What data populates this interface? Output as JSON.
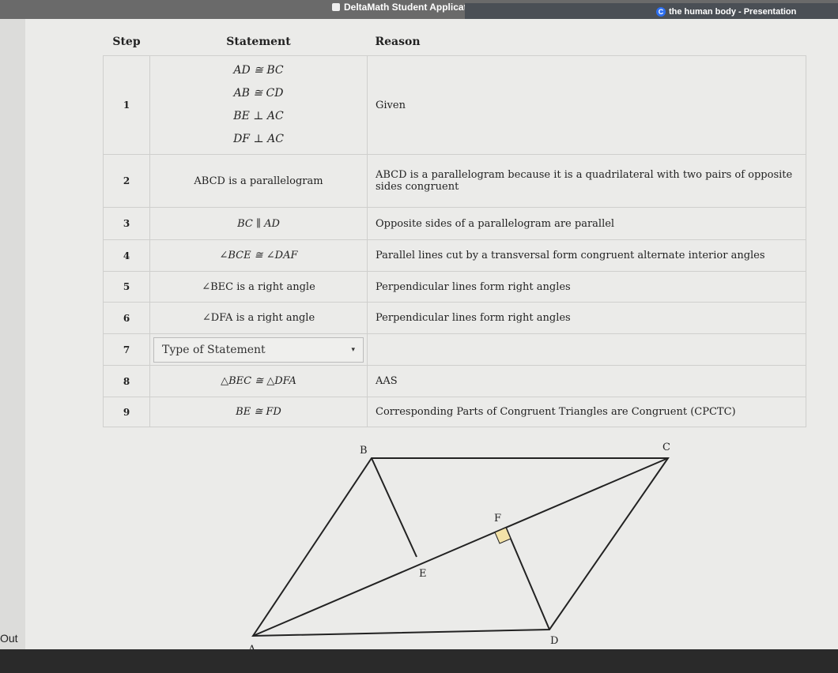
{
  "browser": {
    "tabs": [
      {
        "label": "DeltaMath Student Application"
      },
      {
        "label": "the human body - Presentation"
      }
    ]
  },
  "sidebar": {
    "out_label": "Out"
  },
  "proof": {
    "headers": {
      "step": "Step",
      "statement": "Statement",
      "reason": "Reason"
    },
    "rows": [
      {
        "step": "1",
        "statements": [
          "AD ≅ BC",
          "AB ≅ CD",
          "BE ⊥ AC",
          "DF ⊥ AC"
        ],
        "reason": "Given"
      },
      {
        "step": "2",
        "statement": "ABCD is a parallelogram",
        "reason": "ABCD is a parallelogram because it is a quadrilateral with two pairs of opposite sides congruent"
      },
      {
        "step": "3",
        "statement": "BC ∥ AD",
        "reason": "Opposite sides of a parallelogram are parallel"
      },
      {
        "step": "4",
        "statement": "∠BCE ≅ ∠DAF",
        "reason": "Parallel lines cut by a transversal form congruent alternate interior angles"
      },
      {
        "step": "5",
        "statement": "∠BEC is a right angle",
        "reason": "Perpendicular lines form right angles"
      },
      {
        "step": "6",
        "statement": "∠DFA is a right angle",
        "reason": "Perpendicular lines form right angles"
      },
      {
        "step": "7",
        "statement": "Type of Statement",
        "reason": ""
      },
      {
        "step": "8",
        "statement": "△BEC ≅ △DFA",
        "reason": "AAS"
      },
      {
        "step": "9",
        "statement": "BE ≅ FD",
        "reason": "Corresponding Parts of Congruent Triangles are Congruent (CPCTC)"
      }
    ]
  },
  "diagram": {
    "labels": {
      "A": "A",
      "B": "B",
      "C": "C",
      "D": "D",
      "E": "E",
      "F": "F"
    }
  }
}
